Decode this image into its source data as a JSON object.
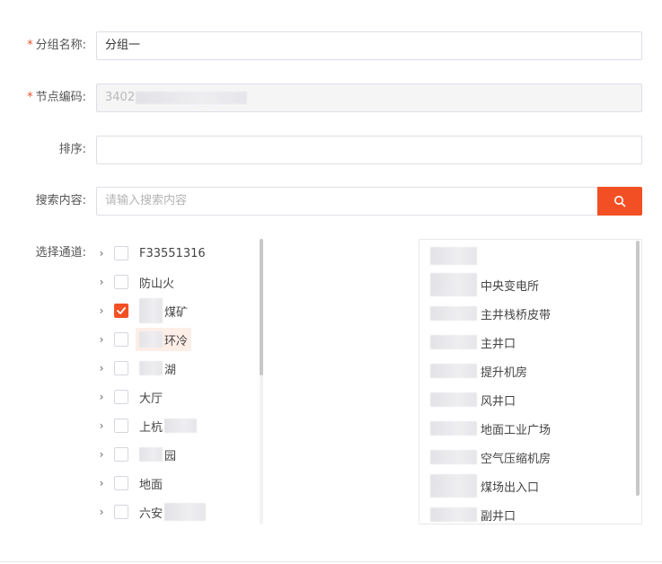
{
  "form": {
    "group_name": {
      "label": "分组名称:",
      "required_mark": "*",
      "value": "分组一"
    },
    "node_code": {
      "label": "节点编码:",
      "required_mark": "*",
      "value": "3402"
    },
    "sort": {
      "label": "排序:",
      "value": ""
    },
    "search": {
      "label": "搜索内容:",
      "placeholder": "请输入搜索内容",
      "icon": "search-icon"
    },
    "channels": {
      "label": "选择通道:"
    }
  },
  "tree": {
    "items": [
      {
        "text": "F33551316",
        "checked": false
      },
      {
        "text": "防山火",
        "checked": false
      },
      {
        "text": "煤矿",
        "checked": true
      },
      {
        "text": "环冷",
        "checked": false
      },
      {
        "text": "湖",
        "checked": false
      },
      {
        "text": "大厅",
        "checked": false
      },
      {
        "text": "上杭",
        "checked": false
      },
      {
        "text": "园",
        "checked": false
      },
      {
        "text": "地面",
        "checked": false
      },
      {
        "text": "六安",
        "checked": false
      }
    ]
  },
  "selected": {
    "items": [
      {
        "text": ""
      },
      {
        "text": "中央变电所"
      },
      {
        "text": "主井栈桥皮带"
      },
      {
        "text": "主井口"
      },
      {
        "text": "提升机房"
      },
      {
        "text": "风井口"
      },
      {
        "text": "地面工业广场"
      },
      {
        "text": "空气压缩机房"
      },
      {
        "text": "煤场出入口"
      },
      {
        "text": "副井口"
      }
    ]
  },
  "colors": {
    "accent": "#f25024",
    "required": "#e8522d",
    "border": "#dcdfe6"
  }
}
